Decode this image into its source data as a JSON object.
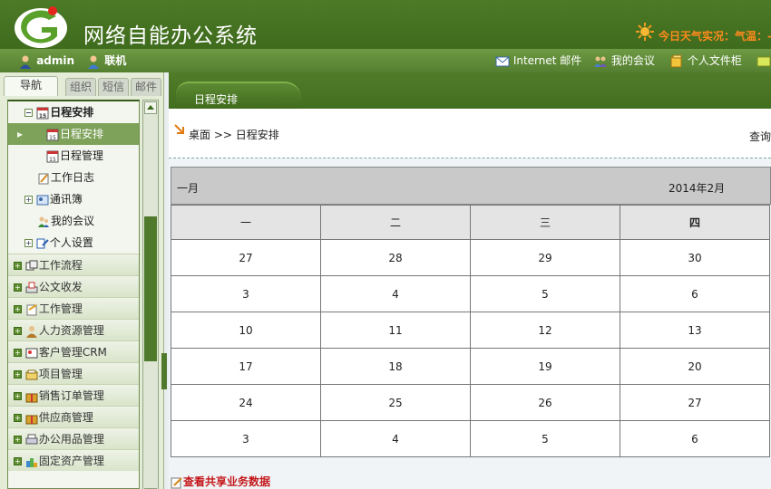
{
  "header": {
    "app_title": "网络自能办公系统",
    "weather": "今日天气实况：气温：-"
  },
  "toolbar": {
    "user": "admin",
    "online": "联机",
    "mail": "Internet 邮件",
    "meeting": "我的会议",
    "folder": "个人文件柜"
  },
  "nav": {
    "tabs": [
      "导航",
      "组织",
      "短信",
      "邮件"
    ],
    "tree": {
      "schedule_group": "日程安排",
      "schedule_item": "日程安排",
      "schedule_manage": "日程管理",
      "work_log": "工作日志",
      "contacts": "通讯簿",
      "my_meeting": "我的会议",
      "personal_settings": "个人设置"
    },
    "groups": [
      "工作流程",
      "公文收发",
      "工作管理",
      "人力资源管理",
      "客户管理CRM",
      "项目管理",
      "销售订单管理",
      "供应商管理",
      "办公用品管理",
      "固定资产管理"
    ]
  },
  "main": {
    "tab_label": "日程安排",
    "breadcrumb": "桌面 >> 日程安排",
    "query_link": "查询",
    "calendar": {
      "prev_label": "一月",
      "month_label": "2014年2月",
      "weekdays": [
        "一",
        "二",
        "三",
        "四"
      ],
      "rows": [
        [
          "27",
          "28",
          "29",
          "30"
        ],
        [
          "3",
          "4",
          "5",
          "6"
        ],
        [
          "10",
          "11",
          "12",
          "13"
        ],
        [
          "17",
          "18",
          "19",
          "20"
        ],
        [
          "24",
          "25",
          "26",
          "27"
        ],
        [
          "3",
          "4",
          "5",
          "6"
        ]
      ]
    },
    "shared_link": "查看共享业务数据"
  },
  "colors": {
    "banner": "#3f6b1d",
    "toolbar": "#6d9a44",
    "weather_text": "#ff8a1c",
    "link_red": "#c4181b"
  }
}
